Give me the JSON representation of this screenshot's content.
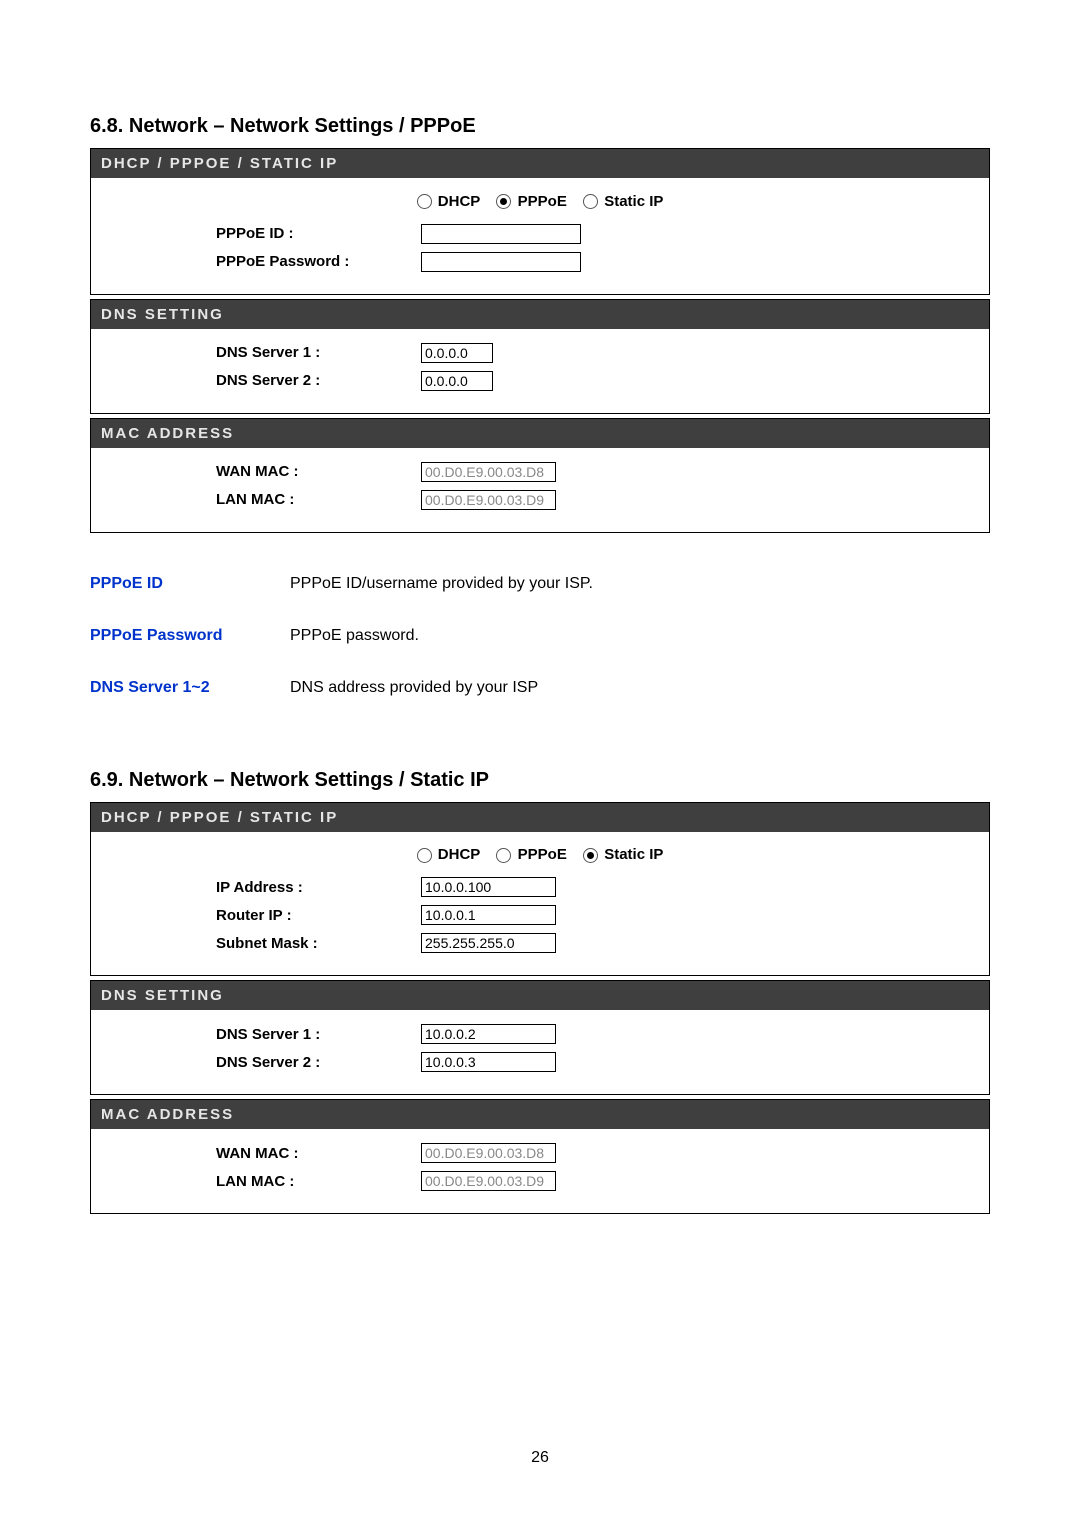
{
  "section68": {
    "heading": "6.8.  Network – Network Settings / PPPoE",
    "panel1": {
      "title": "DHCP / PPPOE / STATIC IP",
      "radios": {
        "dhcp": "DHCP",
        "pppoe": "PPPoE",
        "static": "Static IP",
        "selected": "pppoe"
      },
      "pppoe_id_label": "PPPoE ID :",
      "pppoe_id_value": "",
      "pppoe_pw_label": "PPPoE Password :",
      "pppoe_pw_value": ""
    },
    "panel2": {
      "title": "DNS SETTING",
      "dns1_label": "DNS Server 1 :",
      "dns1_value": "0.0.0.0",
      "dns2_label": "DNS Server 2 :",
      "dns2_value": "0.0.0.0"
    },
    "panel3": {
      "title": "MAC ADDRESS",
      "wan_label": "WAN MAC :",
      "wan_value": "00.D0.E9.00.03.D8",
      "lan_label": "LAN MAC :",
      "lan_value": "00.D0.E9.00.03.D9"
    },
    "desc": [
      {
        "label": "PPPoE ID",
        "text": "PPPoE ID/username provided by your ISP."
      },
      {
        "label": "PPPoE Password",
        "text": "PPPoE password."
      },
      {
        "label": "DNS Server 1~2",
        "text": "DNS address provided by your ISP"
      }
    ]
  },
  "section69": {
    "heading": "6.9.  Network – Network Settings / Static IP",
    "panel1": {
      "title": "DHCP / PPPOE / STATIC IP",
      "radios": {
        "dhcp": "DHCP",
        "pppoe": "PPPoE",
        "static": "Static IP",
        "selected": "static"
      },
      "ip_label": "IP Address :",
      "ip_value": "10.0.0.100",
      "router_label": "Router IP :",
      "router_value": "10.0.0.1",
      "subnet_label": "Subnet Mask :",
      "subnet_value": "255.255.255.0"
    },
    "panel2": {
      "title": "DNS SETTING",
      "dns1_label": "DNS Server 1 :",
      "dns1_value": "10.0.0.2",
      "dns2_label": "DNS Server 2 :",
      "dns2_value": "10.0.0.3"
    },
    "panel3": {
      "title": "MAC ADDRESS",
      "wan_label": "WAN MAC :",
      "wan_value": "00.D0.E9.00.03.D8",
      "lan_label": "LAN MAC :",
      "lan_value": "00.D0.E9.00.03.D9"
    }
  },
  "page_number": "26"
}
